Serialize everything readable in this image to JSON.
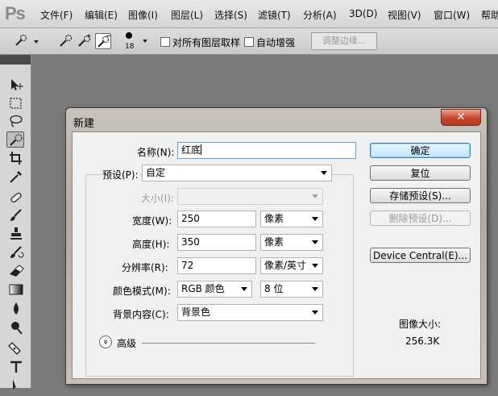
{
  "app": {
    "logo": "Ps"
  },
  "menubar": {
    "items": [
      "文件(F)",
      "编辑(E)",
      "图像(I)",
      "图层(L)",
      "选择(S)",
      "滤镜(T)",
      "分析(A)",
      "3D(D)",
      "视图(V)",
      "窗口(W)",
      "帮助"
    ]
  },
  "options": {
    "brush_size": "18",
    "sample_all_layers": "对所有图层取样",
    "auto_enhance": "自动增强",
    "refine_edge": "调整边缘..."
  },
  "dialog": {
    "title": "新建",
    "close_glyph": "✕",
    "name": {
      "label": "名称(N):",
      "value": "红底"
    },
    "preset": {
      "label": "预设(P):",
      "value": "自定"
    },
    "size": {
      "label": "大小(I):",
      "value": ""
    },
    "width": {
      "label": "宽度(W):",
      "value": "250",
      "unit": "像素"
    },
    "height": {
      "label": "高度(H):",
      "value": "350",
      "unit": "像素"
    },
    "resolution": {
      "label": "分辨率(R):",
      "value": "72",
      "unit": "像素/英寸"
    },
    "color_mode": {
      "label": "颜色模式(M):",
      "mode": "RGB 颜色",
      "depth": "8 位"
    },
    "background": {
      "label": "背景内容(C):",
      "value": "背景色"
    },
    "advanced": {
      "label": "高级",
      "glyph": "»"
    },
    "buttons": {
      "ok": "确定",
      "reset": "复位",
      "save_preset": "存储预设(S)...",
      "delete_preset": "删除预设(D)...",
      "device_central": "Device Central(E)..."
    },
    "image_size": {
      "label": "图像大小:",
      "value": "256.3K"
    }
  }
}
